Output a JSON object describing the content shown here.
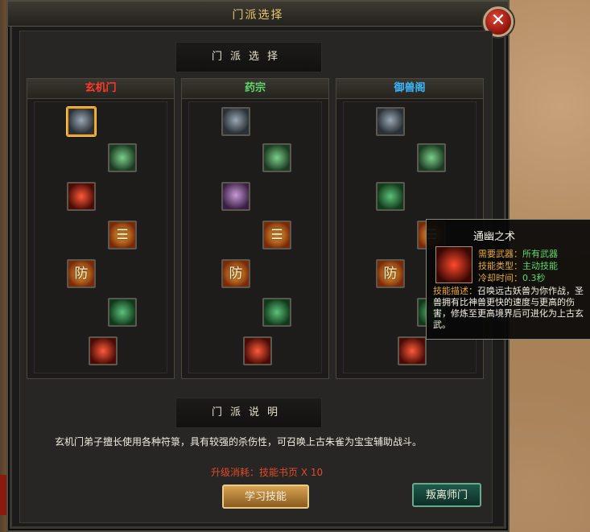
{
  "window": {
    "title": "门派选择",
    "close_symbol": "✕"
  },
  "header": {
    "label": "门派选择"
  },
  "columns": [
    {
      "name": "玄机门",
      "color": "#ff3a2a",
      "skills": [
        "ghost-mask",
        "green-spirit",
        "red-swirl",
        "fire-rune",
        "defense-rune",
        "green-beast",
        "fire-demon"
      ]
    },
    {
      "name": "药宗",
      "color": "#5fd86a",
      "skills": [
        "ghost-mask",
        "green-spirit",
        "purple-skull",
        "fire-rune",
        "defense-rune",
        "green-beast",
        "fire-demon"
      ]
    },
    {
      "name": "御兽阁",
      "color": "#3ab8ff",
      "skills": [
        "ghost-mask",
        "green-spirit",
        "green-leaf",
        "fire-rune",
        "defense-rune",
        "green-beast",
        "fire-demon"
      ]
    }
  ],
  "skill_glyphs": {
    "defense": "防",
    "fire_rune": "☰"
  },
  "description": {
    "header": "门派说明",
    "text": "玄机门弟子擅长使用各种符箓，具有较强的杀伤性，可召唤上古朱雀为宝宝辅助战斗。",
    "cost": "升级消耗：技能书页 X 10"
  },
  "buttons": {
    "learn": "学习技能",
    "leave": "叛离师门"
  },
  "tooltip": {
    "title": "通幽之术",
    "rows": [
      {
        "k": "需要武器：",
        "v": "所有武器"
      },
      {
        "k": "技能类型：",
        "v": "主动技能"
      },
      {
        "k": "冷却时间：",
        "v": "0.3秒"
      }
    ],
    "desc_key": "技能描述：",
    "desc": "召唤远古妖兽为你作战，圣兽拥有比神兽更快的速度与更高的伤害，修炼至更高境界后可进化为上古玄武。"
  }
}
